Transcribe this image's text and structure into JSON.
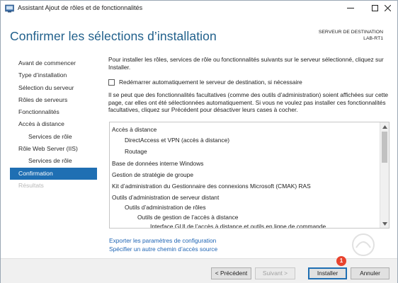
{
  "window": {
    "title": "Assistant Ajout de rôles et de fonctionnalités",
    "controls": [
      "minimize-icon",
      "maximize-icon",
      "close-icon"
    ]
  },
  "header": {
    "title": "Confirmer les sélections d’installation",
    "dest_label": "SERVEUR DE DESTINATION",
    "dest_server": "LAB-RT1"
  },
  "sidebar": {
    "items": [
      {
        "label": "Avant de commencer",
        "state": "normal"
      },
      {
        "label": "Type d’installation",
        "state": "normal"
      },
      {
        "label": "Sélection du serveur",
        "state": "normal"
      },
      {
        "label": "Rôles de serveurs",
        "state": "normal"
      },
      {
        "label": "Fonctionnalités",
        "state": "normal"
      },
      {
        "label": "Accès à distance",
        "state": "normal"
      },
      {
        "label": "Services de rôle",
        "state": "sub"
      },
      {
        "label": "Rôle Web Server (IIS)",
        "state": "normal"
      },
      {
        "label": "Services de rôle",
        "state": "sub"
      },
      {
        "label": "Confirmation",
        "state": "active"
      },
      {
        "label": "Résultats",
        "state": "disabled"
      }
    ]
  },
  "main": {
    "intro": "Pour installer les rôles, services de rôle ou fonctionnalités suivants sur le serveur sélectionné, cliquez sur Installer.",
    "restart_label": "Redémarrer automatiquement le serveur de destination, si nécessaire",
    "restart_checked": false,
    "note": "Il se peut que des fonctionnalités facultatives (comme des outils d’administration) soient affichées sur cette page, car elles ont été sélectionnées automatiquement. Si vous ne voulez pas installer ces fonctionnalités facultatives, cliquez sur Précédent pour désactiver leurs cases à cocher.",
    "list": [
      {
        "text": "Accès à distance",
        "level": 0
      },
      {
        "text": "DirectAccess et VPN (accès à distance)",
        "level": 1
      },
      {
        "text": "Routage",
        "level": 1
      },
      {
        "text": "Base de données interne Windows",
        "level": 0
      },
      {
        "text": "Gestion de stratégie de groupe",
        "level": 0
      },
      {
        "text": "Kit d’administration du Gestionnaire des connexions Microsoft (CMAK) RAS",
        "level": 0
      },
      {
        "text": "Outils d’administration de serveur distant",
        "level": 0
      },
      {
        "text": "Outils d’administration de rôles",
        "level": 1
      },
      {
        "text": "Outils de gestion de l’accès à distance",
        "level": 2
      },
      {
        "text": "Interface GUI de l’accès à distance et outils en ligne de commande",
        "level": 3
      }
    ],
    "link_export": "Exporter les paramètres de configuration",
    "link_source": "Spécifier un autre chemin d’accès source"
  },
  "footer": {
    "prev": "< Précédent",
    "next": "Suivant >",
    "install": "Installer",
    "cancel": "Annuler",
    "badge": "1"
  },
  "colors": {
    "title_blue": "#1f5f8b",
    "active_bg": "#1f6fb3",
    "link": "#1e64b4",
    "badge": "#e8432e"
  }
}
